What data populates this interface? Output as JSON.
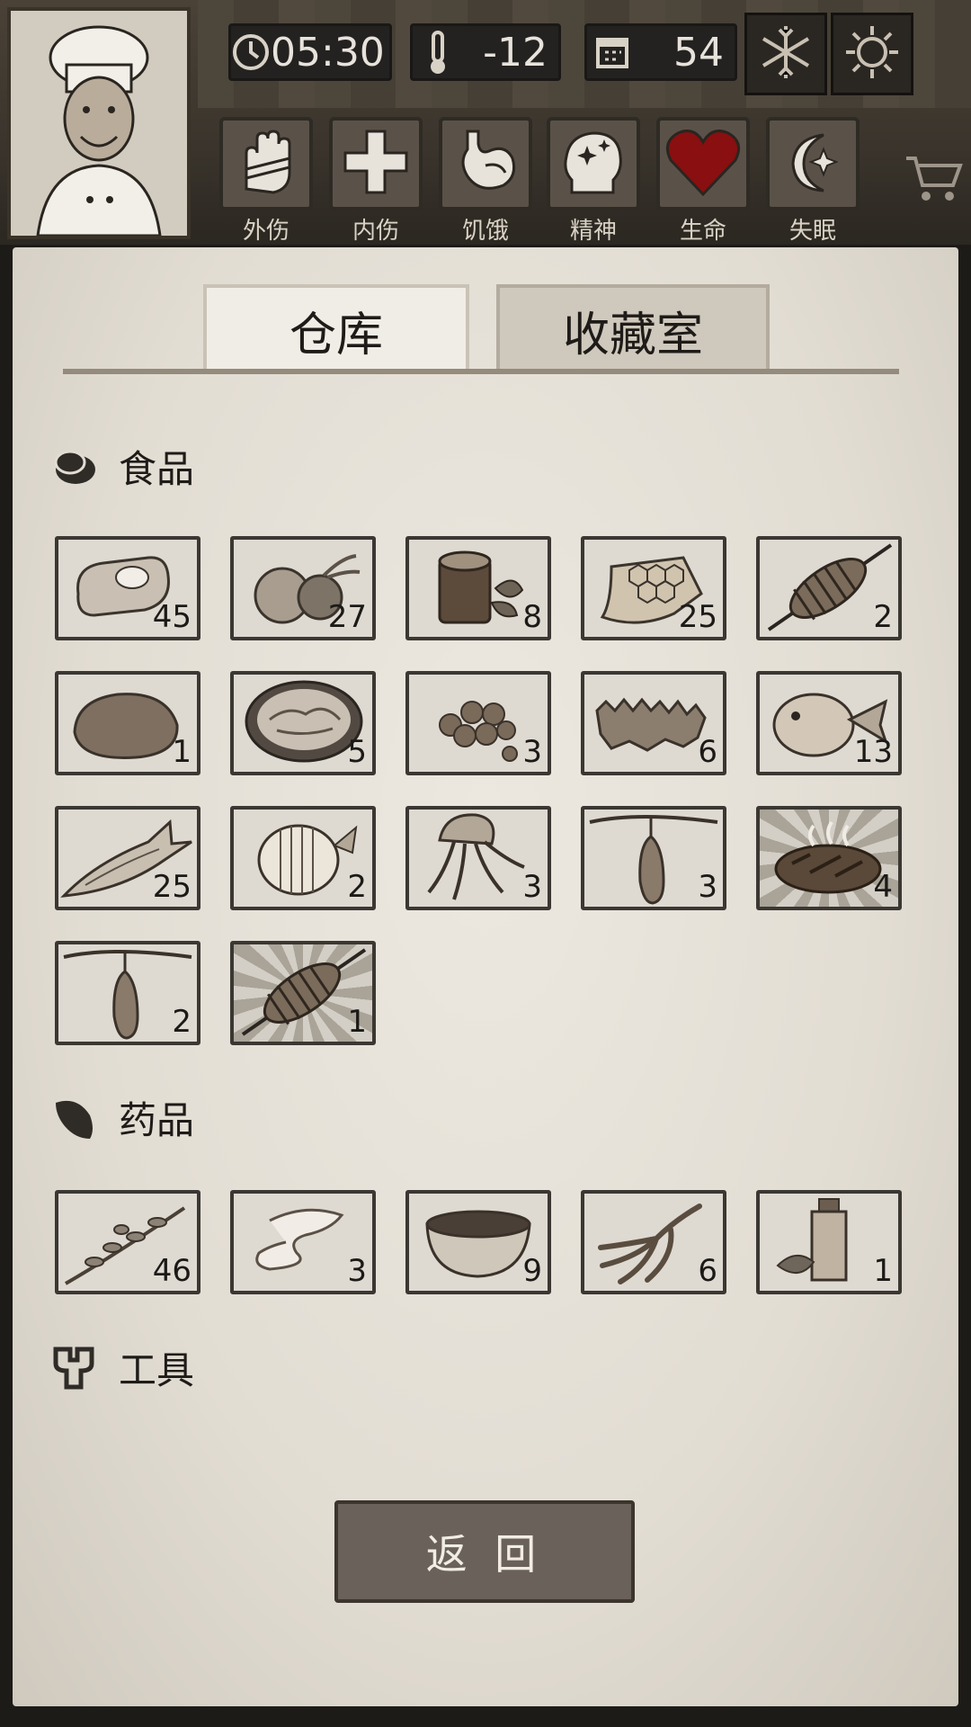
{
  "hud": {
    "time": "05:30",
    "temperature": "-12",
    "days": "54"
  },
  "statuses": [
    {
      "label": "外伤",
      "icon": "bandaged-hand-icon"
    },
    {
      "label": "内伤",
      "icon": "cross-icon"
    },
    {
      "label": "饥饿",
      "icon": "stomach-icon"
    },
    {
      "label": "精神",
      "icon": "head-stars-icon"
    },
    {
      "label": "生命",
      "icon": "heart-icon"
    },
    {
      "label": "失眠",
      "icon": "moon-star-icon"
    }
  ],
  "tabs": {
    "warehouse": "仓库",
    "collection": "收藏室"
  },
  "sections": {
    "food": "食品",
    "medicine": "药品",
    "tools": "工具"
  },
  "food_items": [
    {
      "icon": "steak-icon",
      "count": "45"
    },
    {
      "icon": "coconut-icon",
      "count": "27"
    },
    {
      "icon": "wood-log-icon",
      "count": "8"
    },
    {
      "icon": "honeycomb-icon",
      "count": "25"
    },
    {
      "icon": "skewer-icon",
      "count": "2"
    },
    {
      "icon": "potato-icon",
      "count": "1"
    },
    {
      "icon": "rice-bowl-icon",
      "count": "5"
    },
    {
      "icon": "nuts-icon",
      "count": "3"
    },
    {
      "icon": "sea-cucumber-icon",
      "count": "6"
    },
    {
      "icon": "pufferfish-icon",
      "count": "13"
    },
    {
      "icon": "salmon-icon",
      "count": "25"
    },
    {
      "icon": "butterflyfish-icon",
      "count": "2"
    },
    {
      "icon": "jellyfish-icon",
      "count": "3"
    },
    {
      "icon": "hanging-gourd-icon",
      "count": "3"
    },
    {
      "icon": "grilled-steak-icon",
      "count": "4"
    },
    {
      "icon": "hanging-gourd-icon",
      "count": "2"
    },
    {
      "icon": "skewer-icon",
      "count": "1"
    }
  ],
  "medicine_items": [
    {
      "icon": "herb-branch-icon",
      "count": "46"
    },
    {
      "icon": "bandage-icon",
      "count": "3"
    },
    {
      "icon": "medicine-bowl-icon",
      "count": "9"
    },
    {
      "icon": "ginseng-icon",
      "count": "6"
    },
    {
      "icon": "medicine-bottle-icon",
      "count": "1"
    }
  ],
  "back_button": "返 回"
}
